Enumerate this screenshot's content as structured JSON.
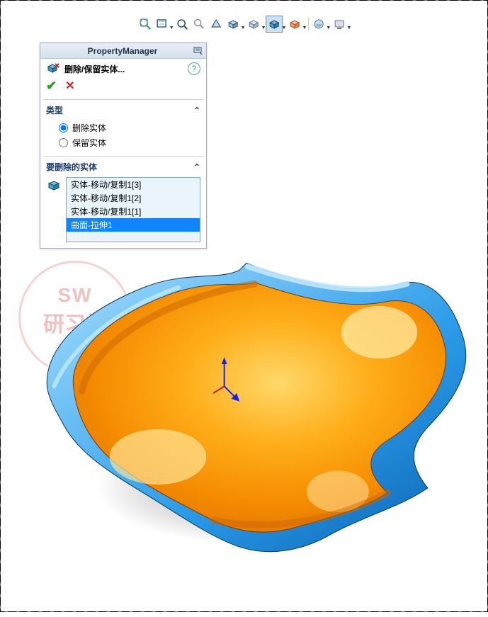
{
  "toolbar": {
    "zoom_fit": "zoom-fit",
    "zoom_area": "zoom-area",
    "zoom_in": "zoom-in",
    "zoom_out": "zoom-out",
    "rotate": "rotate",
    "section": "section",
    "display": "display",
    "shaded_edges": "shaded-edges",
    "perspective": "perspective",
    "appearance": "appearance",
    "scene": "scene",
    "screen": "screen"
  },
  "pm": {
    "title": "PropertyManager",
    "feature_name": "删除/保留实体...",
    "type_label": "类型",
    "radio_delete": "删除实体",
    "radio_keep": "保留实体",
    "bodies_label": "要删除的实体",
    "bodies": [
      "实体-移动/复制1[3]",
      "实体-移动/复制1[2]",
      "实体-移动/复制1[1]",
      "曲面-拉伸1"
    ],
    "selected_index": 3
  },
  "watermark": {
    "line1": "SW",
    "line2": "研习社",
    "line3": "SolidWorks"
  }
}
